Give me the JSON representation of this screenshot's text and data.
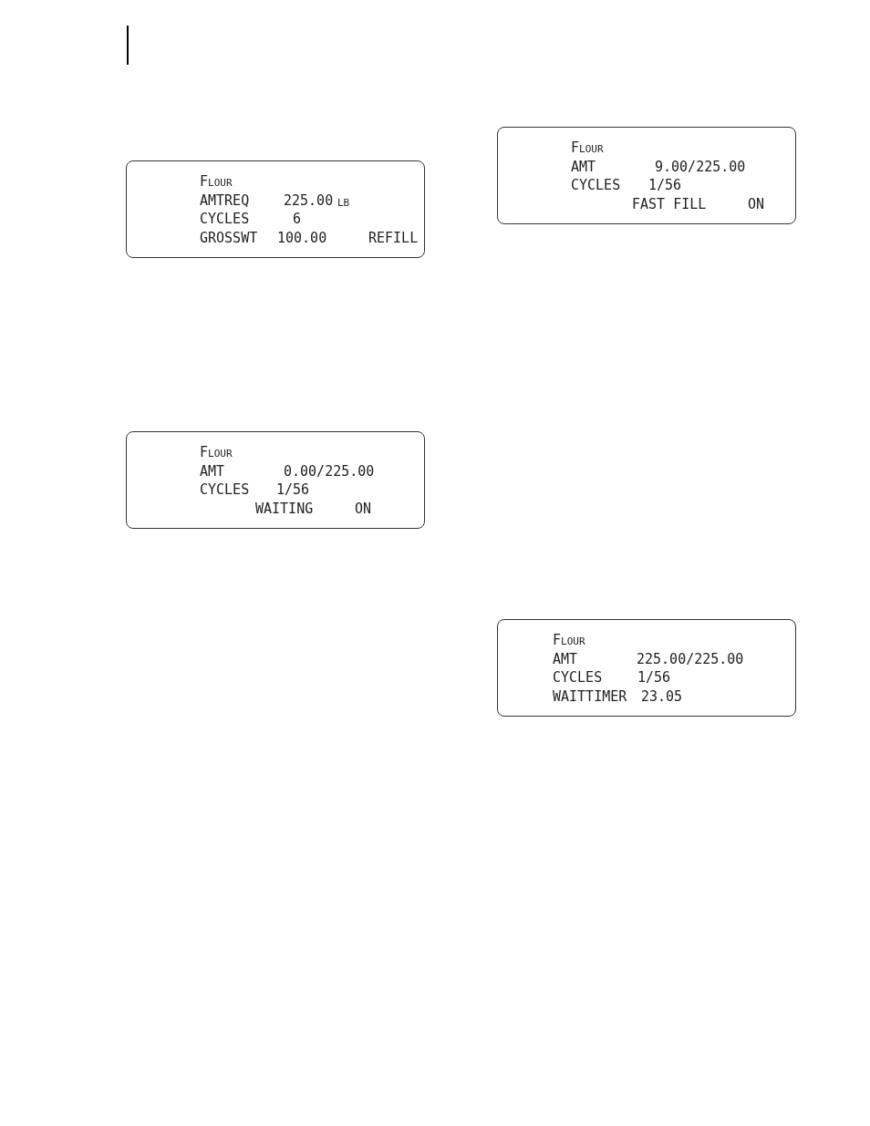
{
  "displays": [
    {
      "title": "Flour",
      "rows": [
        {
          "label": "AMTREQ",
          "value": "225.00",
          "unit": "lb"
        },
        {
          "label": "CYCLES",
          "value": "6"
        },
        {
          "label": "GROSSWT",
          "value": "100.00",
          "status": "REFILL"
        }
      ]
    },
    {
      "title": "Flour",
      "rows": [
        {
          "label": "AMT",
          "value": "0.00/225.00"
        },
        {
          "label": "CYCLES",
          "value": "1/56"
        },
        {
          "label": "WAITING",
          "status": "ON"
        }
      ]
    },
    {
      "title": "Flour",
      "rows": [
        {
          "label": "AMT",
          "value": "9.00/225.00"
        },
        {
          "label": "CYCLES",
          "value": "1/56"
        },
        {
          "label": "FAST FILL",
          "status": "ON"
        }
      ]
    },
    {
      "title": "Flour",
      "rows": [
        {
          "label": "AMT",
          "value": "225.00/225.00"
        },
        {
          "label": "CYCLES",
          "value": "1/56"
        },
        {
          "label": "WAITTIMER",
          "value": "23.05"
        }
      ]
    }
  ]
}
